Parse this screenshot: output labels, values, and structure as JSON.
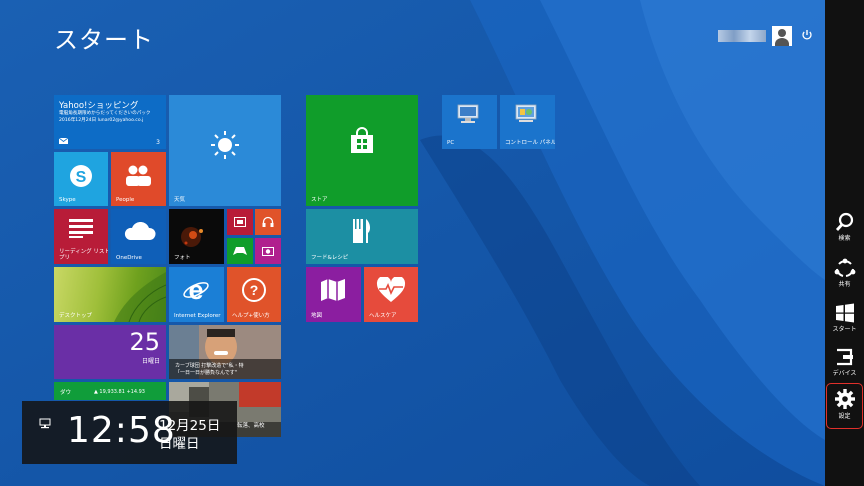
{
  "screen": {
    "title": "スタート",
    "user_name": "•••••"
  },
  "tiles": {
    "yahoo": {
      "title": "Yahoo!ショッピング",
      "line1": "電脳角長期限めからだってくださいのパック",
      "line2": "2016年12月24日 lunar02@yahoo.co.j",
      "count": "3"
    },
    "weather": {
      "label": "天気"
    },
    "skype": {
      "label": "Skype"
    },
    "people": {
      "label": "People"
    },
    "reading": {
      "label": "リーディング リスト ア\nプリ"
    },
    "onedrive": {
      "label": "OneDrive"
    },
    "photos": {
      "label": "フォト"
    },
    "desktop": {
      "label": "デスクトップ"
    },
    "ie": {
      "label": "Internet Explorer"
    },
    "help": {
      "label": "ヘルプ+使い方"
    },
    "calendar": {
      "day": "25",
      "weekday": "日曜日"
    },
    "news": {
      "text1": "カーブ球団 打撃改造で\"私・特",
      "text2": "「一日一日が勝負なんです\""
    },
    "finance": {
      "name": "ダウ",
      "value": "▲ 19,933.81 +14.93"
    },
    "sports": {
      "text": "転落、高校"
    },
    "store": {
      "label": "ストア"
    },
    "food": {
      "label": "フード&レシピ"
    },
    "maps": {
      "label": "地図"
    },
    "health": {
      "label": "ヘルスケア"
    },
    "pc": {
      "label": "PC"
    },
    "control_panel": {
      "label": "コントロール パネル"
    }
  },
  "clock": {
    "time": "12:58",
    "date": "12月25日",
    "weekday": "日曜日"
  },
  "charms": [
    {
      "label": "検索",
      "icon": "search-icon"
    },
    {
      "label": "共有",
      "icon": "share-icon"
    },
    {
      "label": "スタート",
      "icon": "windows-logo-icon"
    },
    {
      "label": "デバイス",
      "icon": "devices-icon"
    },
    {
      "label": "設定",
      "icon": "gear-icon"
    }
  ],
  "colors": {
    "background": "#1456a8",
    "skype": "#1fa4e0",
    "people": "#e04a2a",
    "reading": "#b81c38",
    "onedrive": "#0f5fb8",
    "store": "#109d2a",
    "food": "#1c8fa3",
    "maps": "#8b1ea0",
    "health": "#e64b3c",
    "finance": "#109d3a",
    "calendar": "#6a2fa6",
    "charm_highlight": "#e0302b"
  }
}
